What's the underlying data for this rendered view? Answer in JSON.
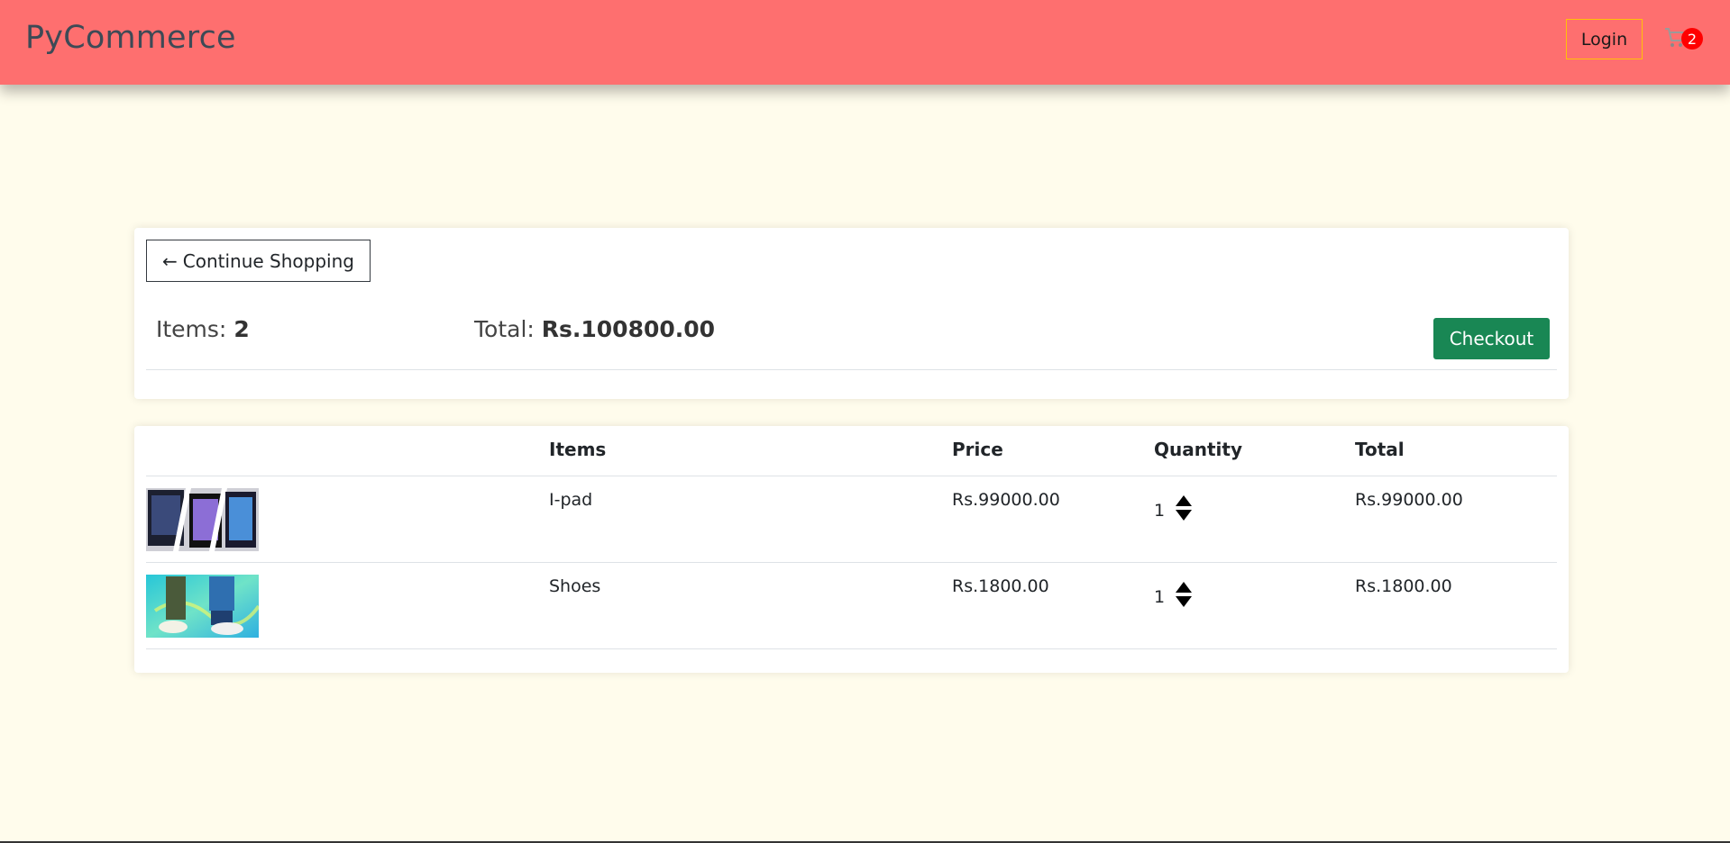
{
  "app": {
    "brand": "PyCommerce"
  },
  "nav": {
    "login_label": "Login",
    "cart_count": "2",
    "cart_icon": "cart-icon"
  },
  "summary": {
    "continue_label": "Continue Shopping",
    "items_label": "Items:",
    "items_count": "2",
    "total_label": "Total:",
    "total_value": "Rs.100800.00",
    "checkout_label": "Checkout"
  },
  "cart": {
    "columns": [
      "",
      "Items",
      "Price",
      "Quantity",
      "Total"
    ],
    "rows": [
      {
        "name": "I-pad",
        "price": "Rs.99000.00",
        "quantity": "1",
        "total": "Rs.99000.00",
        "image": "ipad-product-image"
      },
      {
        "name": "Shoes",
        "price": "Rs.1800.00",
        "quantity": "1",
        "total": "Rs.1800.00",
        "image": "shoes-product-image"
      }
    ]
  },
  "colors": {
    "navbar": "#fe6f6f",
    "background": "#fffcec",
    "checkout": "#198754",
    "login_border": "#ffc107",
    "badge": "#ff0000"
  }
}
